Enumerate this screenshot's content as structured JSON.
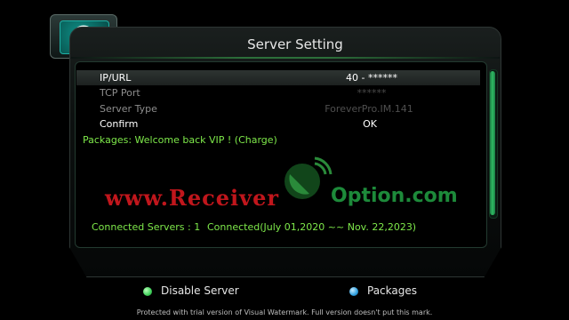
{
  "header": {
    "title": "Server Setting",
    "app_icon": "server-satellite-icon"
  },
  "settings": [
    {
      "label": "IP/URL",
      "value": "40 - ******",
      "selected": true
    },
    {
      "label": "TCP Port",
      "value": "******",
      "dimmed": true
    },
    {
      "label": "Server Type",
      "value": "ForeverPro.IM.141",
      "dimmed": true
    },
    {
      "label": "Confirm",
      "value": "OK"
    }
  ],
  "packages_line": "Packages: Welcome back VIP ! (Charge)",
  "status": {
    "connected_label": "Connected Servers : 1",
    "connected_detail": "Connected(July 01,2020 ~~ Nov. 22,2023)"
  },
  "watermark": {
    "left": "www.Receiver",
    "right": "Option.com"
  },
  "footer": {
    "disable_label": "Disable Server",
    "packages_label": "Packages",
    "green_color": "#3fd05a",
    "blue_color": "#2e9fe0"
  },
  "notice": "Protected with trial version of Visual Watermark. Full version doesn't put this mark."
}
